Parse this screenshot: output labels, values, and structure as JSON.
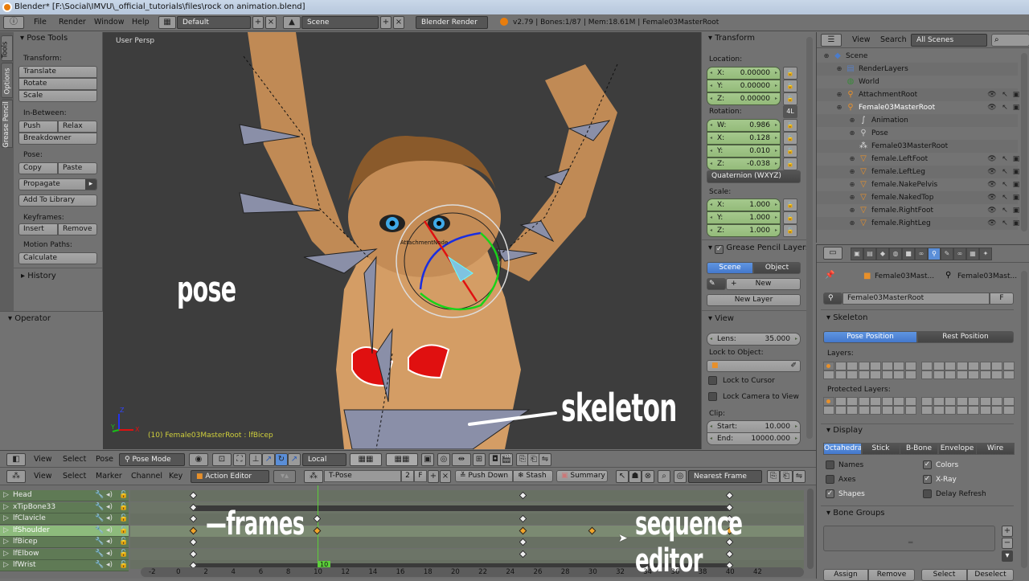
{
  "window": {
    "title": "Blender* [F:\\Social\\IMVU\\_official_tutorials\\files\\rock on animation.blend]"
  },
  "topbar": {
    "menus": [
      "File",
      "Render",
      "Window",
      "Help"
    ],
    "screen_layout": "Default",
    "scene": "Scene",
    "render_engine": "Blender Render",
    "info": "v2.79 | Bones:1/87 | Mem:18.61M | Female03MasterRoot"
  },
  "tool_tabs": [
    "Tools",
    "Options",
    "Grease Pencil"
  ],
  "pose_tools": {
    "title": "Pose Tools",
    "transform_label": "Transform:",
    "translate": "Translate",
    "rotate": "Rotate",
    "scale": "Scale",
    "inbetween_label": "In-Between:",
    "push": "Push",
    "relax": "Relax",
    "breakdowner": "Breakdowner",
    "pose_label": "Pose:",
    "copy": "Copy",
    "paste": "Paste",
    "propagate": "Propagate",
    "add_to_library": "Add To Library",
    "keyframes_label": "Keyframes:",
    "insert": "Insert",
    "remove": "Remove",
    "motion_paths_label": "Motion Paths:",
    "calculate": "Calculate",
    "history": "History",
    "operator": "Operator"
  },
  "viewport": {
    "view_name": "User Persp",
    "status": "(10) Female03MasterRoot : lfBicep",
    "axis_labels": {
      "x": "X",
      "y": "Y",
      "z": "Z"
    },
    "bone_label": "AttachmentNode",
    "annotations": {
      "pose": "pose",
      "skeleton": "skeleton"
    }
  },
  "transform_panel": {
    "title": "Transform",
    "location_label": "Location:",
    "location": [
      {
        "k": "X:",
        "v": "0.00000"
      },
      {
        "k": "Y:",
        "v": "0.00000"
      },
      {
        "k": "Z:",
        "v": "0.00000"
      }
    ],
    "rotation_label": "Rotation:",
    "rotation_lock_4l": "4L",
    "rotation": [
      {
        "k": "W:",
        "v": "0.986"
      },
      {
        "k": "X:",
        "v": "0.128"
      },
      {
        "k": "Y:",
        "v": "0.010"
      },
      {
        "k": "Z:",
        "v": "-0.038"
      }
    ],
    "rotation_mode": "Quaternion (WXYZ)",
    "scale_label": "Scale:",
    "scale": [
      {
        "k": "X:",
        "v": "1.000"
      },
      {
        "k": "Y:",
        "v": "1.000"
      },
      {
        "k": "Z:",
        "v": "1.000"
      }
    ]
  },
  "grease_pencil": {
    "title": "Grease Pencil Layers",
    "enabled": true,
    "scene": "Scene",
    "object": "Object",
    "new": "New",
    "new_layer": "New Layer"
  },
  "view_panel": {
    "title": "View",
    "lens_label": "Lens:",
    "lens_value": "35.000",
    "lock_to_object_label": "Lock to Object:",
    "lock_to_cursor": "Lock to Cursor",
    "lock_camera_to_view": "Lock Camera to View",
    "clip_label": "Clip:",
    "clip_start_label": "Start:",
    "clip_start": "10.000",
    "clip_end_label": "End:",
    "clip_end": "10000.000"
  },
  "outliner": {
    "view": "View",
    "search": "Search",
    "filter": "All Scenes",
    "rows": [
      {
        "name": "Scene",
        "indent": 0,
        "icon": "scene"
      },
      {
        "name": "RenderLayers",
        "indent": 1,
        "icon": "renderlayers"
      },
      {
        "name": "World",
        "indent": 1,
        "icon": "world"
      },
      {
        "name": "AttachmentRoot",
        "indent": 1,
        "icon": "armature"
      },
      {
        "name": "Female03MasterRoot",
        "indent": 1,
        "icon": "armature",
        "selected": true
      },
      {
        "name": "Animation",
        "indent": 2,
        "icon": "action"
      },
      {
        "name": "Pose",
        "indent": 2,
        "icon": "pose"
      },
      {
        "name": "Female03MasterRoot",
        "indent": 2,
        "icon": "armature-data"
      },
      {
        "name": "female.LeftFoot",
        "indent": 2,
        "icon": "mesh"
      },
      {
        "name": "female.LeftLeg",
        "indent": 2,
        "icon": "mesh"
      },
      {
        "name": "female.NakePelvis",
        "indent": 2,
        "icon": "mesh"
      },
      {
        "name": "female.NakedTop",
        "indent": 2,
        "icon": "mesh"
      },
      {
        "name": "female.RightFoot",
        "indent": 2,
        "icon": "mesh"
      },
      {
        "name": "female.RightLeg",
        "indent": 2,
        "icon": "mesh"
      }
    ]
  },
  "properties": {
    "breadcrumb": [
      "Female03Mast...",
      "Female03Mast..."
    ],
    "datablock": "Female03MasterRoot",
    "fake_user": "F",
    "skeleton_title": "Skeleton",
    "pose_position": "Pose Position",
    "rest_position": "Rest Position",
    "layers_label": "Layers:",
    "protected_layers_label": "Protected Layers:",
    "display_title": "Display",
    "display_types": [
      "Octahedral",
      "Stick",
      "B-Bone",
      "Envelope",
      "Wire"
    ],
    "display_active": "Octahedral",
    "names": "Names",
    "names_checked": false,
    "axes": "Axes",
    "axes_checked": false,
    "shapes": "Shapes",
    "shapes_checked": true,
    "colors": "Colors",
    "colors_checked": true,
    "xray": "X-Ray",
    "xray_checked": true,
    "delay_refresh": "Delay Refresh",
    "delay_refresh_checked": false,
    "bone_groups_title": "Bone Groups",
    "assign": "Assign",
    "remove": "Remove",
    "select": "Select",
    "deselect": "Deselect"
  },
  "view3d_header": {
    "menus": [
      "View",
      "Select",
      "Pose"
    ],
    "mode": "Pose Mode",
    "orientation": "Local"
  },
  "dopesheet_header": {
    "menus": [
      "View",
      "Select",
      "Marker",
      "Channel",
      "Key"
    ],
    "editor_mode": "Action Editor",
    "action": "T-Pose",
    "users": "2",
    "fake_user": "F",
    "push_down": "Push Down",
    "stash": "Stash",
    "summary": "Summary",
    "snap": "Nearest Frame"
  },
  "channels": [
    {
      "name": "Head",
      "selected": false
    },
    {
      "name": "xTipBone33",
      "selected": false
    },
    {
      "name": "lfClavicle",
      "selected": false
    },
    {
      "name": "lfShoulder",
      "selected": true
    },
    {
      "name": "lfBicep",
      "selected": false
    },
    {
      "name": "lfElbow",
      "selected": false
    },
    {
      "name": "lfWrist",
      "selected": false
    }
  ],
  "timeline": {
    "current_frame": 10,
    "ticks": [
      "-2",
      "0",
      "2",
      "4",
      "6",
      "8",
      "10",
      "12",
      "14",
      "16",
      "18",
      "20",
      "22",
      "24",
      "26",
      "28",
      "30",
      "32",
      "34",
      "36",
      "38",
      "40",
      "42"
    ],
    "keyframes": [
      {
        "row": 0,
        "frames": [
          1,
          25,
          40
        ],
        "selected": []
      },
      {
        "row": 1,
        "frames": [
          1,
          40
        ],
        "selected": []
      },
      {
        "row": 2,
        "frames": [
          1,
          10,
          25,
          40
        ],
        "selected": []
      },
      {
        "row": 3,
        "frames": [
          1,
          10,
          25,
          30,
          40
        ],
        "selected": [
          1,
          10,
          25,
          30,
          40
        ]
      },
      {
        "row": 4,
        "frames": [
          1,
          25,
          40
        ],
        "selected": []
      },
      {
        "row": 5,
        "frames": [
          1,
          25,
          40
        ],
        "selected": []
      },
      {
        "row": 6,
        "frames": [
          1,
          40
        ],
        "selected": []
      }
    ],
    "annotations": {
      "frames": "—frames",
      "sequence_editor": "sequence editor"
    }
  }
}
